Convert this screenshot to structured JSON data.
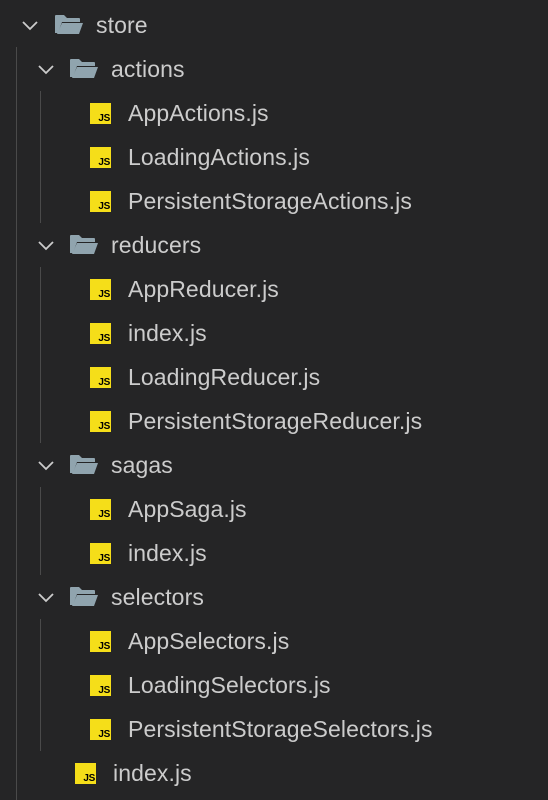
{
  "colors": {
    "background": "#252526",
    "text": "#cccccc",
    "js_badge": "#f5de19",
    "folder": "#90a4ae",
    "indent_guide": "#4a4a4a"
  },
  "icons": {
    "chevron": "chevron-down-icon",
    "folder": "folder-open-icon",
    "file": "js-file-icon"
  },
  "js_badge_text": "JS",
  "explorer": {
    "root": {
      "name": "store",
      "expanded": true,
      "folders": [
        {
          "name": "actions",
          "expanded": true,
          "files": [
            "AppActions.js",
            "LoadingActions.js",
            "PersistentStorageActions.js"
          ]
        },
        {
          "name": "reducers",
          "expanded": true,
          "files": [
            "AppReducer.js",
            "index.js",
            "LoadingReducer.js",
            "PersistentStorageReducer.js"
          ]
        },
        {
          "name": "sagas",
          "expanded": true,
          "files": [
            "AppSaga.js",
            "index.js"
          ]
        },
        {
          "name": "selectors",
          "expanded": true,
          "files": [
            "AppSelectors.js",
            "LoadingSelectors.js",
            "PersistentStorageSelectors.js"
          ]
        }
      ],
      "files": [
        "index.js"
      ]
    }
  }
}
